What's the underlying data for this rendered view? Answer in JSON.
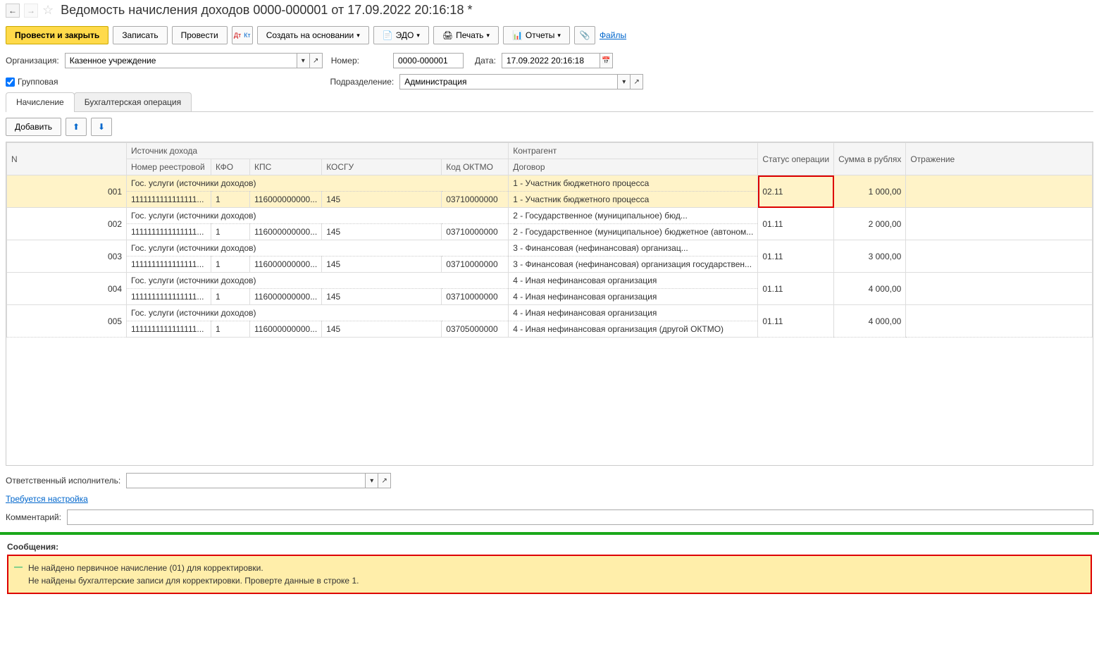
{
  "title": "Ведомость начисления доходов 0000-000001 от 17.09.2022 20:16:18 *",
  "toolbar": {
    "post_close": "Провести и закрыть",
    "save": "Записать",
    "post": "Провести",
    "create_based": "Создать на основании",
    "edo": "ЭДО",
    "print": "Печать",
    "reports": "Отчеты",
    "files": "Файлы"
  },
  "form": {
    "org_label": "Организация:",
    "org_value": "Казенное учреждение",
    "number_label": "Номер:",
    "number_value": "0000-000001",
    "date_label": "Дата:",
    "date_value": "17.09.2022 20:16:18",
    "group_label": "Групповая",
    "subdiv_label": "Подразделение:",
    "subdiv_value": "Администрация"
  },
  "tabs": {
    "accrual": "Начисление",
    "accounting": "Бухгалтерская операция"
  },
  "subtoolbar": {
    "add": "Добавить"
  },
  "table_headers": {
    "n": "N",
    "source": "Источник дохода",
    "reg_num": "Номер реестровой",
    "kfo": "КФО",
    "kps": "КПС",
    "kosgu": "КОСГУ",
    "oktmo": "Код ОКТМО",
    "contragent": "Контрагент",
    "contract": "Договор",
    "status": "Статус операции",
    "sum": "Сумма в рублях",
    "reflection": "Отражение"
  },
  "rows": [
    {
      "n": "001",
      "src": "Гос. услуги (источники доходов)",
      "reg": "1111111111111111...",
      "kfo": "1",
      "kps": "116000000000...",
      "kosgu": "145",
      "oktmo": "03710000000",
      "contr1": "1 - Участник бюджетного процесса",
      "contr2": "1 - Участник бюджетного процесса",
      "status": "02.11",
      "sum": "1 000,00",
      "selected": true,
      "highlight": true
    },
    {
      "n": "002",
      "src": "Гос. услуги (источники доходов)",
      "reg": "1111111111111111...",
      "kfo": "1",
      "kps": "116000000000...",
      "kosgu": "145",
      "oktmo": "03710000000",
      "contr1": "2 - Государственное (муниципальное) бюд...",
      "contr2": "2 - Государственное (муниципальное) бюджетное (автоном...",
      "status": "01.11",
      "sum": "2 000,00"
    },
    {
      "n": "003",
      "src": "Гос. услуги (источники доходов)",
      "reg": "1111111111111111...",
      "kfo": "1",
      "kps": "116000000000...",
      "kosgu": "145",
      "oktmo": "03710000000",
      "contr1": "3 - Финансовая (нефинансовая) организац...",
      "contr2": "3 - Финансовая (нефинансовая) организация государствен...",
      "status": "01.11",
      "sum": "3 000,00"
    },
    {
      "n": "004",
      "src": "Гос. услуги (источники доходов)",
      "reg": "1111111111111111...",
      "kfo": "1",
      "kps": "116000000000...",
      "kosgu": "145",
      "oktmo": "03710000000",
      "contr1": "4 - Иная нефинансовая организация",
      "contr2": "4 - Иная нефинансовая организация",
      "status": "01.11",
      "sum": "4 000,00"
    },
    {
      "n": "005",
      "src": "Гос. услуги (источники доходов)",
      "reg": "1111111111111111...",
      "kfo": "1",
      "kps": "116000000000...",
      "kosgu": "145",
      "oktmo": "03705000000",
      "contr1": "4 - Иная нефинансовая организация",
      "contr2": "4 - Иная нефинансовая организация (другой ОКТМО)",
      "status": "01.11",
      "sum": "4 000,00"
    }
  ],
  "footer": {
    "responsible_label": "Ответственный исполнитель:",
    "need_setup": "Требуется настройка",
    "comment_label": "Комментарий:"
  },
  "messages": {
    "title": "Сообщения:",
    "line1": "Не найдено первичное начисление (01) для корректировки.",
    "line2": "Не найдены бухгалтерские записи для корректировки. Проверте данные в строке 1."
  }
}
